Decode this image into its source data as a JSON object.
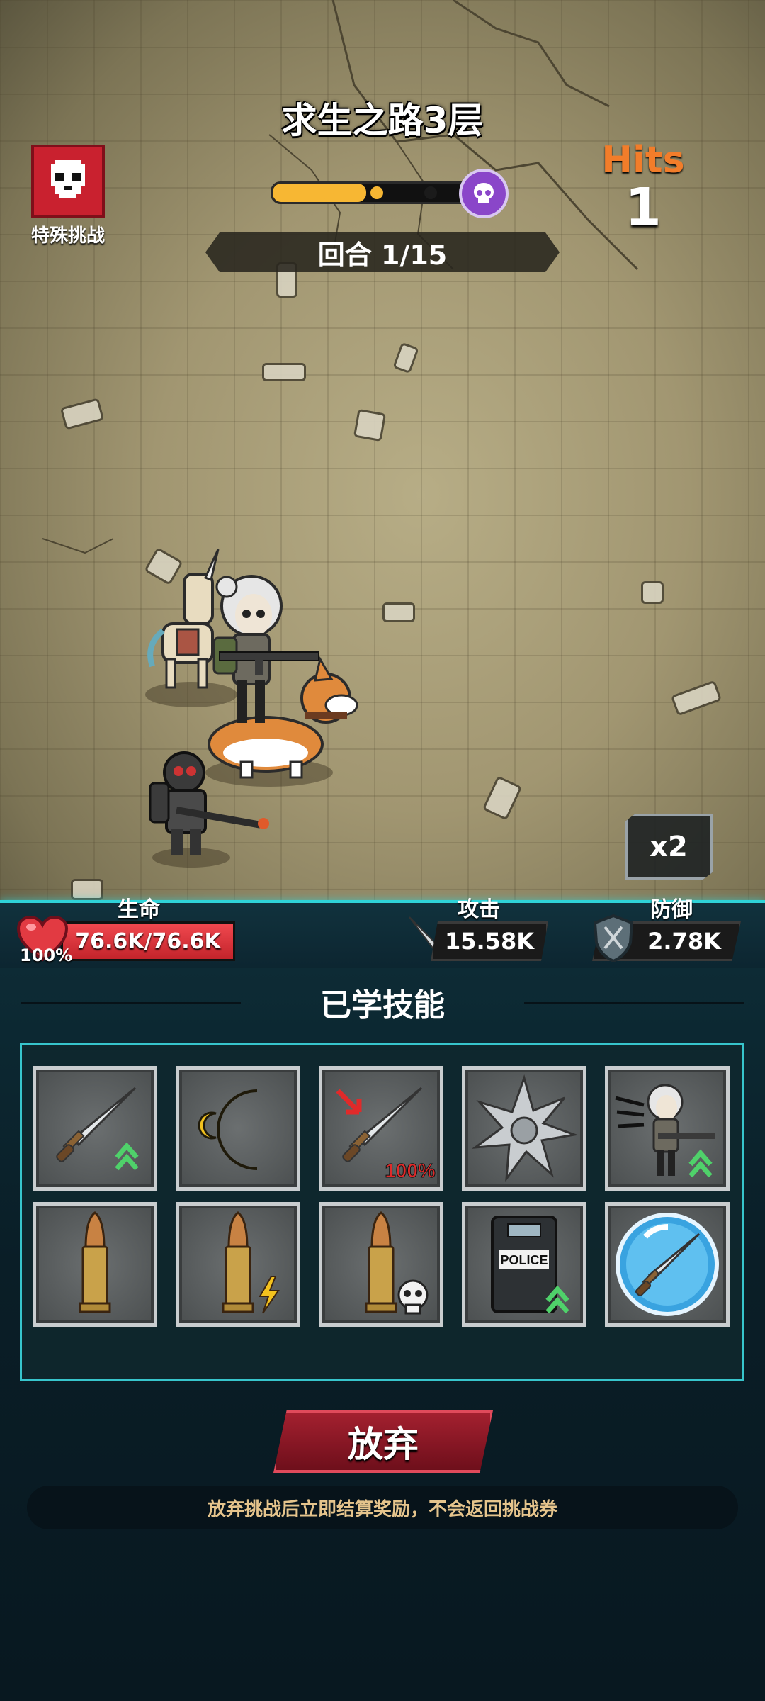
{
  "level": {
    "title": "求生之路3层",
    "progress_percent": 44
  },
  "round": {
    "label": "回合 1/15"
  },
  "special_challenge": {
    "label": "特殊挑战",
    "icon": "skull-icon"
  },
  "hits": {
    "label": "Hits",
    "count": "1"
  },
  "speed": {
    "label": "x2"
  },
  "stats": {
    "hp_label": "生命",
    "hp_value": "76.6K/76.6K",
    "hp_percent": "100%",
    "hp_fill": 100,
    "attack_label": "攻击",
    "attack_value": "15.58K",
    "defense_label": "防御",
    "defense_value": "2.78K"
  },
  "skills": {
    "title": "已学技能",
    "items": [
      {
        "icon": "dagger-icon",
        "badge": "upgrade-arrows"
      },
      {
        "icon": "crescent-moon-icon"
      },
      {
        "icon": "dagger-crit-icon",
        "badge_text": "100%"
      },
      {
        "icon": "shuriken-icon"
      },
      {
        "icon": "survivor-gunner-icon",
        "badge": "upgrade-arrows"
      },
      {
        "icon": "bullet-icon"
      },
      {
        "icon": "bullet-lightning-icon"
      },
      {
        "icon": "bullet-skull-icon"
      },
      {
        "icon": "police-shield-icon",
        "badge": "upgrade-arrows",
        "shield_text": "POLICE"
      },
      {
        "icon": "dagger-bubble-icon"
      }
    ]
  },
  "abandon": {
    "label": "放弃",
    "notice": "放弃挑战后立即结算奖励，不会返回挑战券"
  },
  "colors": {
    "accent": "#2fd3d8",
    "hits": "#f27d2a",
    "hp": "#e23a42",
    "progress": "#f7b733",
    "danger": "#a3202f"
  }
}
